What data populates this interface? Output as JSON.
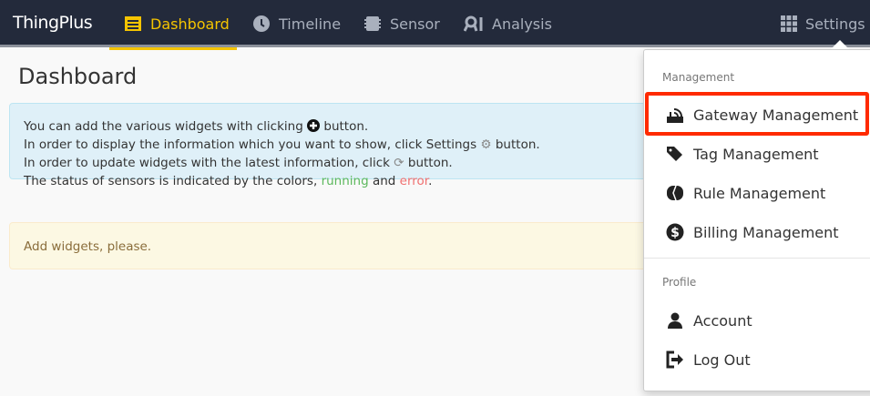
{
  "nav": {
    "brand": "ThingPlus",
    "items": [
      {
        "label": "Dashboard",
        "icon": "dashboard-icon",
        "active": true
      },
      {
        "label": "Timeline",
        "icon": "clock-icon"
      },
      {
        "label": "Sensor",
        "icon": "chip-icon"
      },
      {
        "label": "Analysis",
        "icon": "analysis-icon"
      }
    ],
    "settings": "Settings"
  },
  "page": {
    "title": "Dashboard",
    "info": {
      "line1a": "You can add the various widgets with clicking",
      "line1b": "button.",
      "line2a": "In order to display the information which you want to show, click Settings",
      "line2b": "button.",
      "line3a": "In order to update widgets with the latest information, click",
      "line3b": "button.",
      "line4a": "The status of sensors is indicated by the colors,",
      "running": "running",
      "and": "and",
      "error": "error",
      "end": "."
    },
    "warning": "Add widgets, please."
  },
  "menu": {
    "management_header": "Management",
    "items": [
      "Gateway Management",
      "Tag Management",
      "Rule Management",
      "Billing Management"
    ],
    "profile_header": "Profile",
    "profile_items": [
      "Account",
      "Log Out"
    ]
  },
  "colors": {
    "nav": "#232a3b",
    "accent": "#f5c400",
    "highlight": "#ff2a00"
  }
}
